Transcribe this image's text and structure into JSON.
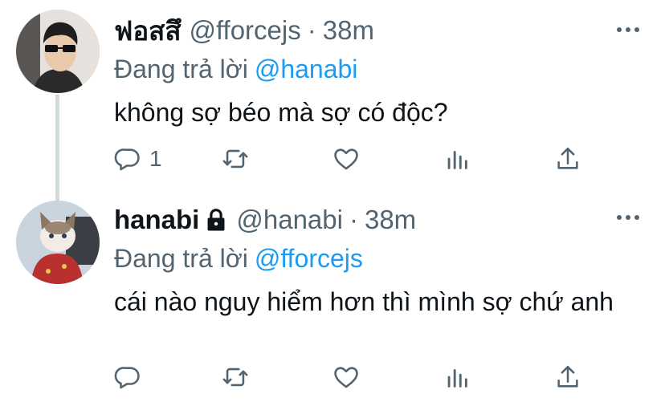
{
  "tweets": [
    {
      "name": "ฟอสสึ",
      "handle": "@fforcejs",
      "separator": "·",
      "time": "38m",
      "replying_prefix": "Đang trả lời",
      "replying_to": "@hanabi",
      "text": "không sợ béo mà sợ có độc?",
      "reply_count": "1",
      "locked": false
    },
    {
      "name": "hanabi",
      "handle": "@hanabi",
      "separator": "·",
      "time": "38m",
      "replying_prefix": "Đang trả lời",
      "replying_to": "@fforcejs",
      "text": "cái nào nguy hiểm hơn thì mình sợ chứ anh",
      "reply_count": "",
      "locked": true
    }
  ],
  "colors": {
    "text": "#0f1419",
    "secondary": "#536471",
    "link": "#1d9bf0",
    "thread_line": "#cfd9de"
  },
  "icons": [
    "reply-icon",
    "retweet-icon",
    "like-icon",
    "analytics-icon",
    "share-icon",
    "more-icon",
    "lock-icon"
  ]
}
